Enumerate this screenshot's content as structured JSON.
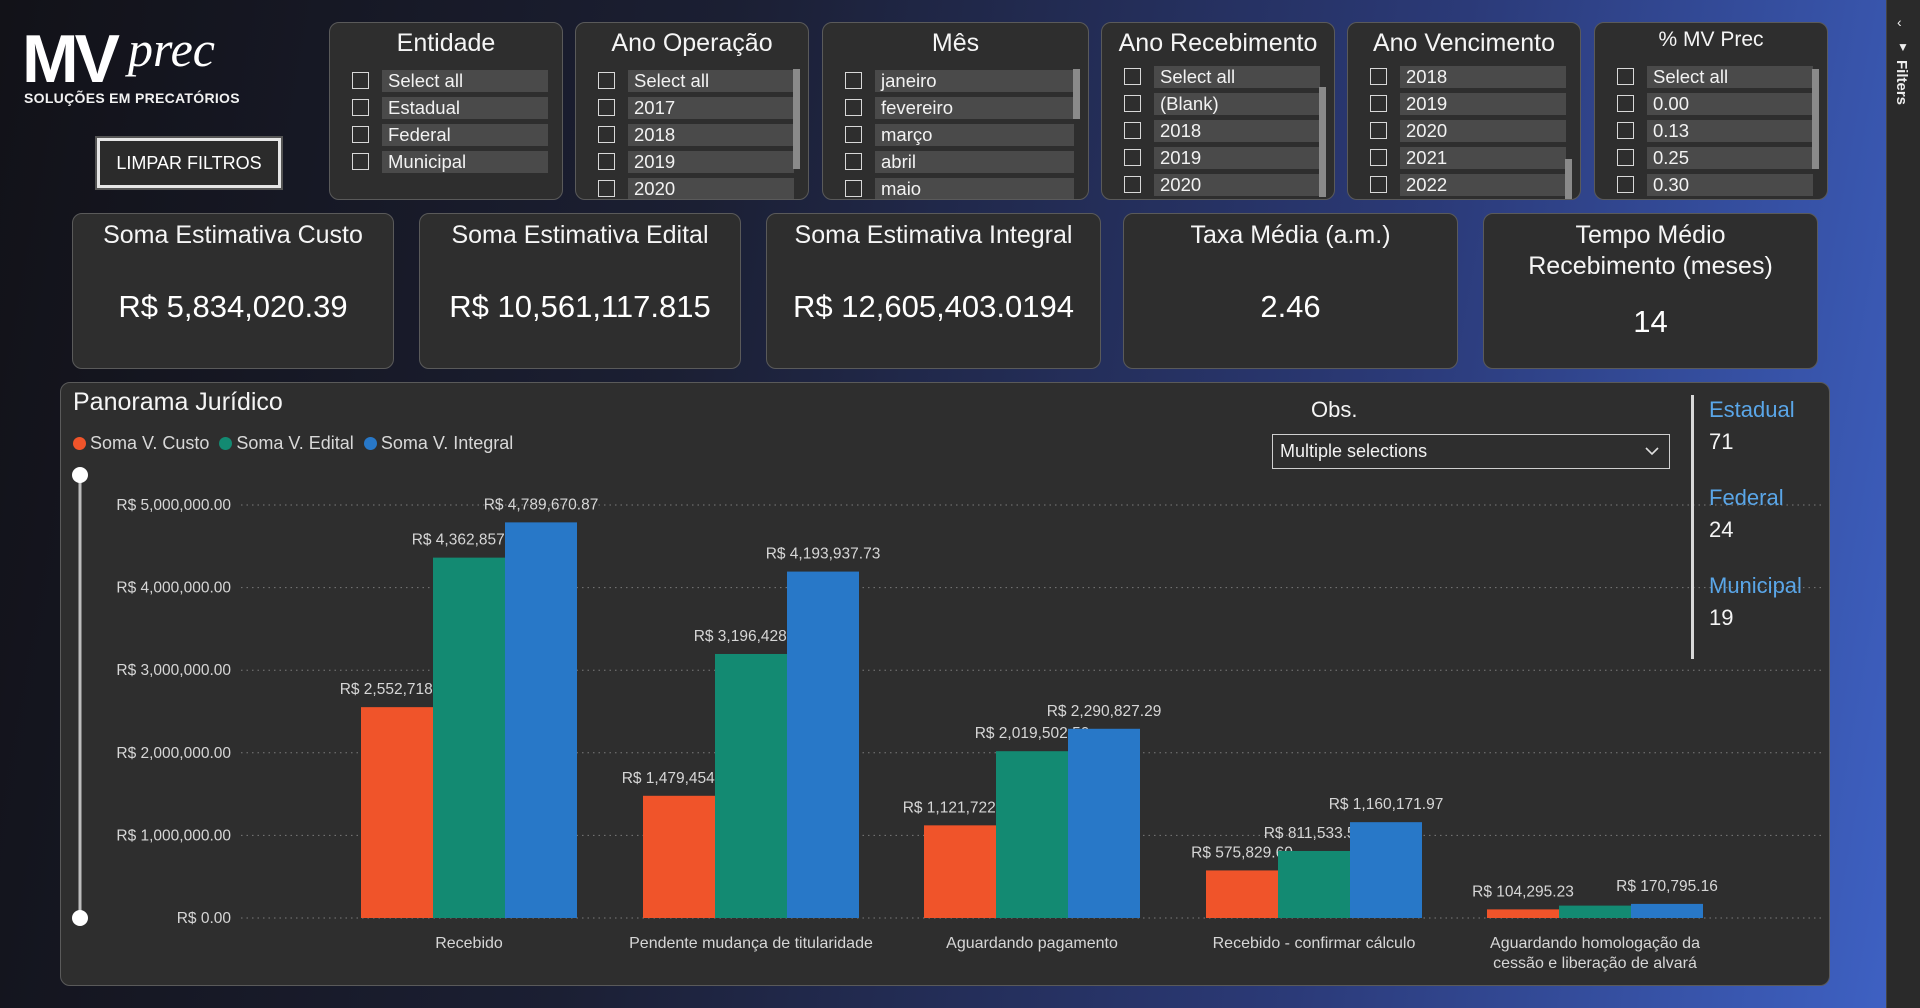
{
  "logo": {
    "main": "MV",
    "script": "prec",
    "subtitle": "SOLUÇÕES EM PRECATÓRIOS"
  },
  "clear_button": "LIMPAR FILTROS",
  "slicers": [
    {
      "title": "Entidade",
      "items": [
        "Select all",
        "Estadual",
        "Federal",
        "Municipal"
      ]
    },
    {
      "title": "Ano Operação",
      "items": [
        "Select all",
        "2017",
        "2018",
        "2019",
        "2020"
      ]
    },
    {
      "title": "Mês",
      "items": [
        "janeiro",
        "fevereiro",
        "março",
        "abril",
        "maio"
      ]
    },
    {
      "title": "Ano Recebimento",
      "items": [
        "Select all",
        "(Blank)",
        "2018",
        "2019",
        "2020"
      ]
    },
    {
      "title": "Ano Vencimento",
      "items": [
        "2018",
        "2019",
        "2020",
        "2021",
        "2022"
      ]
    },
    {
      "title": "% MV Prec",
      "items": [
        "Select all",
        "0.00",
        "0.13",
        "0.25",
        "0.30"
      ]
    }
  ],
  "kpis": [
    {
      "title": "Soma Estimativa Custo",
      "value": "R$ 5,834,020.39"
    },
    {
      "title": "Soma Estimativa Edital",
      "value": "R$ 10,561,117.815"
    },
    {
      "title": "Soma Estimativa Integral",
      "value": "R$ 12,605,403.0194"
    },
    {
      "title": "Taxa Média (a.m.)",
      "value": "2.46"
    },
    {
      "title": "Tempo Médio Recebimento (meses)",
      "value": "14"
    }
  ],
  "panel": {
    "title": "Panorama Jurídico",
    "obs_label": "Obs.",
    "obs_value": "Multiple selections",
    "entity_cards": [
      {
        "label": "Estadual",
        "value": "71"
      },
      {
        "label": "Federal",
        "value": "24"
      },
      {
        "label": "Municipal",
        "value": "19"
      }
    ]
  },
  "filters_pane": {
    "label": "Filters"
  },
  "colors": {
    "custo": "#f0542a",
    "edital": "#138a72",
    "integral": "#2878c8"
  },
  "chart_data": {
    "type": "bar",
    "categories": [
      "Recebido",
      "Pendente mudança de titularidade",
      "Aguardando pagamento",
      "Recebido - confirmar cálculo",
      "Aguardando homologação da cessão e liberação de alvará"
    ],
    "series": [
      {
        "name": "Soma V. Custo",
        "values": [
          2552718.17,
          1479454.48,
          1121722.91,
          575829.6,
          104295.23
        ],
        "labels": [
          "R$ 2,552,718.17",
          "R$ 1,479,454.48",
          "R$ 1,121,722.91",
          "R$ 575,829.60",
          "R$ 104,295.23"
        ]
      },
      {
        "name": "Soma V. Edital",
        "values": [
          4362857.92,
          3196428.66,
          2019502.5,
          811533.58,
          150000
        ],
        "labels": [
          "R$ 4,362,857.92",
          "R$ 3,196,428.66",
          "R$ 2,019,502.50",
          "R$ 811,533.58",
          ""
        ]
      },
      {
        "name": "Soma V. Integral",
        "values": [
          4789670.87,
          4193937.73,
          2290827.29,
          1160171.97,
          170795.16
        ],
        "labels": [
          "R$ 4,789,670.87",
          "R$ 4,193,937.73",
          "R$ 2,290,827.29",
          "R$ 1,160,171.97",
          "R$ 170,795.16"
        ]
      }
    ],
    "yticks": [
      0,
      1000000,
      2000000,
      3000000,
      4000000,
      5000000
    ],
    "ytick_labels": [
      "R$ 0.00",
      "R$ 1,000,000.00",
      "R$ 2,000,000.00",
      "R$ 3,000,000.00",
      "R$ 4,000,000.00",
      "R$ 5,000,000.00"
    ],
    "ylim": [
      0,
      5000000
    ],
    "grid": true,
    "legend": "top-left"
  }
}
